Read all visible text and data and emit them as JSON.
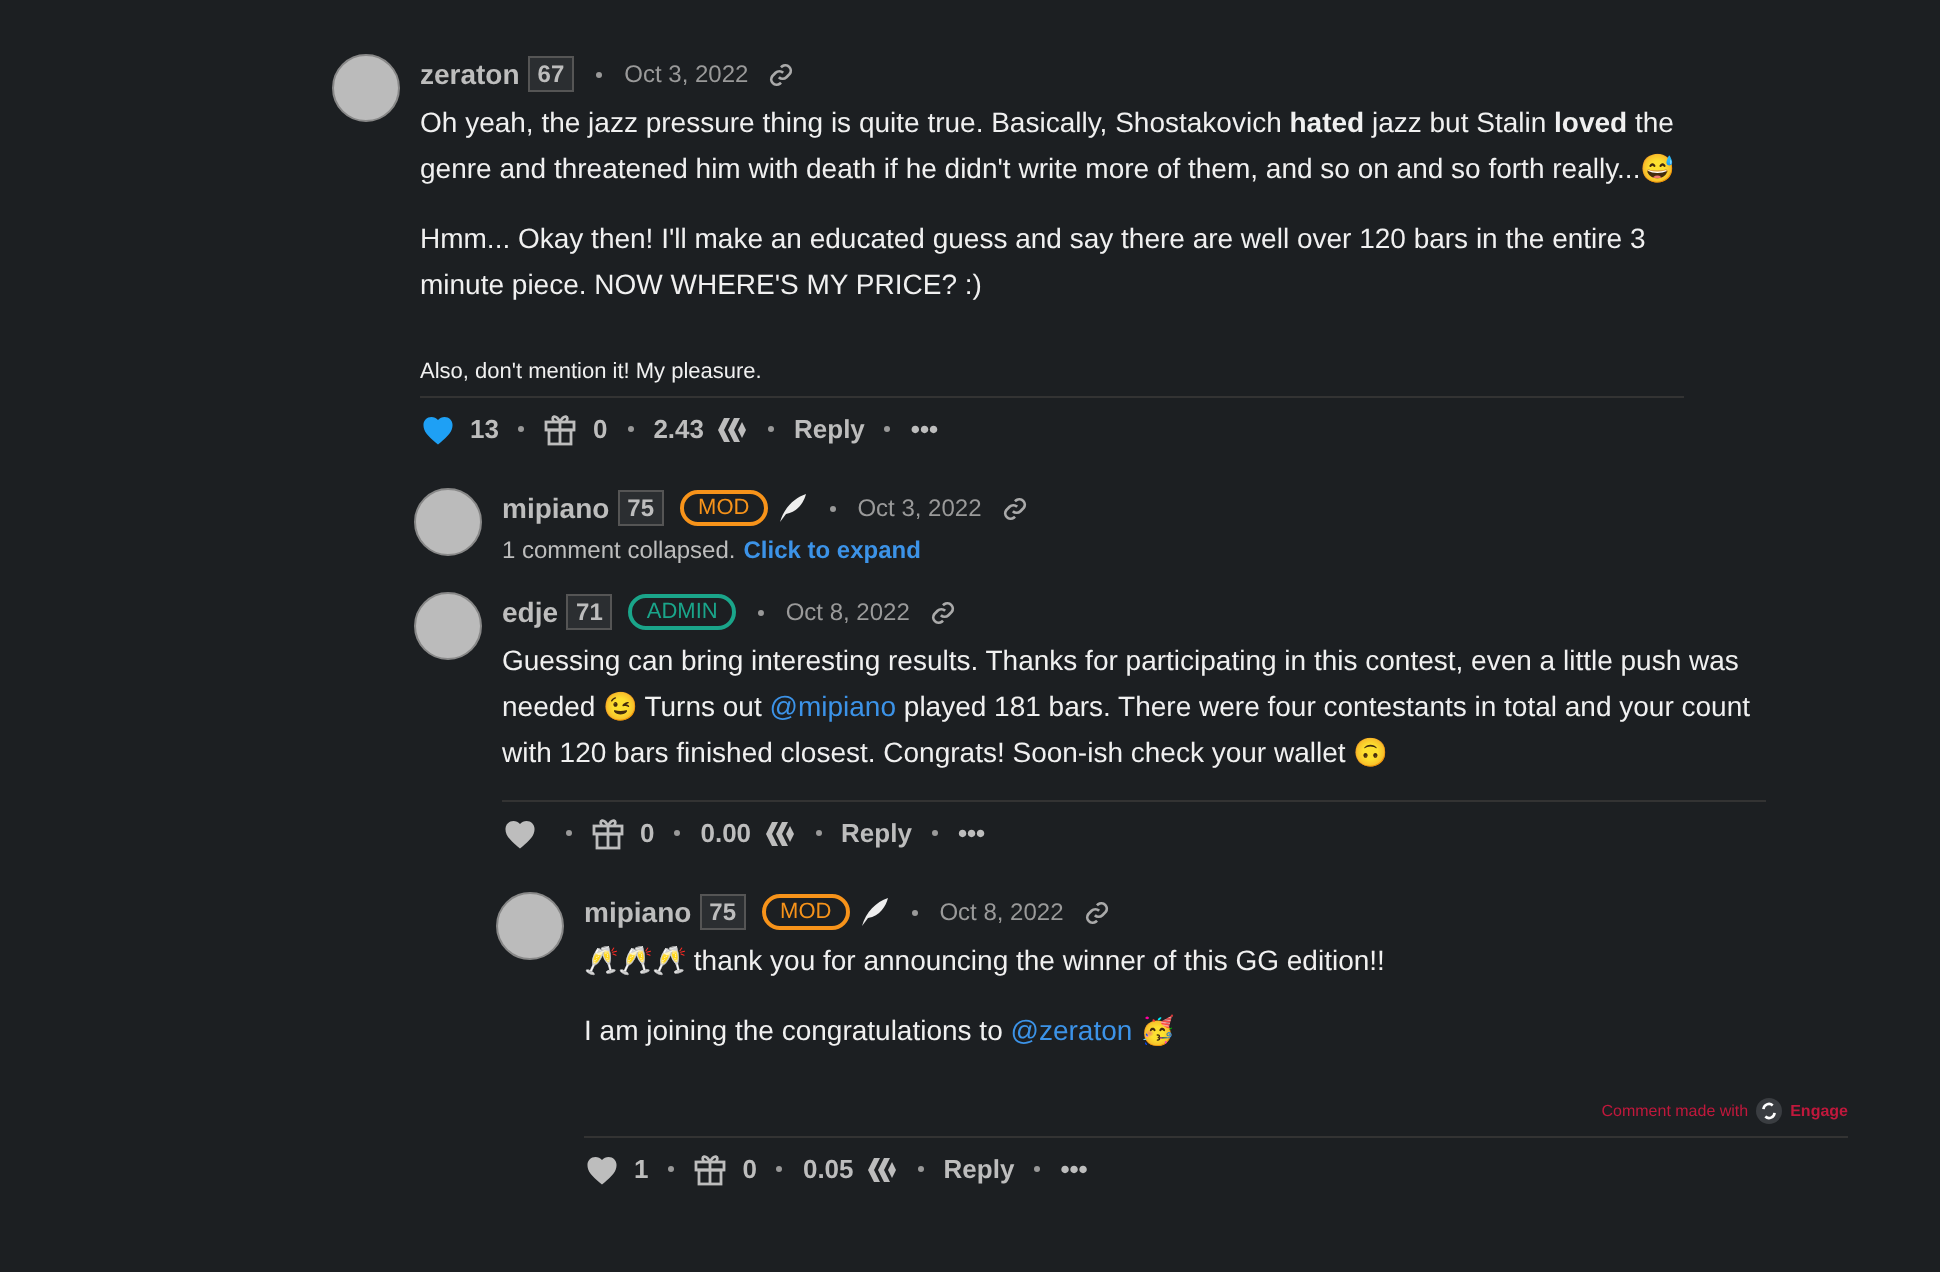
{
  "comments": [
    {
      "author": "zeraton",
      "reputation": "67",
      "date": "Oct 3, 2022",
      "paragraphs": [
        [
          {
            "kind": "text",
            "text": "Oh yeah, the jazz pressure thing is quite true. Basically, Shostakovich **hated** jazz but Stalin **loved** the genre and threatened him with death if he didn't write more of them, and so on and so forth really...😅"
          }
        ],
        [
          {
            "kind": "text",
            "text": "Hmm... Okay then! I'll make an educated guess and say there are well over 120 bars in the entire 3 minute piece. NOW WHERE'S MY PRICE? :)"
          }
        ]
      ],
      "note": "Also, don't mention it! My pleasure.",
      "actions": {
        "liked": true,
        "votes": "13",
        "gifts": "0",
        "payout": "2.43",
        "reply": "Reply",
        "more": "•••"
      },
      "children": [
        {
          "author": "mipiano",
          "reputation": "75",
          "role": {
            "kind": "mod",
            "label": "MOD"
          },
          "feather": true,
          "date": "Oct 3, 2022",
          "collapsed": {
            "text": "1 comment collapsed.",
            "link": "Click to expand"
          }
        },
        {
          "author": "edje",
          "reputation": "71",
          "role": {
            "kind": "admin",
            "label": "ADMIN"
          },
          "date": "Oct 8, 2022",
          "paragraphs": [
            [
              {
                "kind": "text",
                "text": "Guessing can bring interesting results. Thanks for participating in this contest, even a little push was needed 😉 Turns out "
              },
              {
                "kind": "mention",
                "text": "@mipiano"
              },
              {
                "kind": "text",
                "text": " played 181 bars. There were four contestants in total and your count with 120 bars finished closest. Congrats! Soon-ish check your wallet 🙃"
              }
            ]
          ],
          "actions": {
            "liked": false,
            "gifts": "0",
            "payout": "0.00",
            "reply": "Reply",
            "more": "•••"
          },
          "children": [
            {
              "author": "mipiano",
              "reputation": "75",
              "role": {
                "kind": "mod",
                "label": "MOD"
              },
              "feather": true,
              "date": "Oct 8, 2022",
              "paragraphs": [
                [
                  {
                    "kind": "text",
                    "text": "🥂🥂🥂 thank you for announcing the winner of this GG edition!!"
                  }
                ],
                [
                  {
                    "kind": "text",
                    "text": "I am joining the congratulations to "
                  },
                  {
                    "kind": "mention",
                    "text": "@zeraton"
                  },
                  {
                    "kind": "text",
                    "text": " 🥳"
                  }
                ]
              ],
              "footer": {
                "text": "Comment made with",
                "app": "Engage"
              },
              "actions": {
                "liked": false,
                "votes": "1",
                "gifts": "0",
                "payout": "0.05",
                "reply": "Reply",
                "more": "•••"
              }
            }
          ]
        }
      ]
    }
  ]
}
